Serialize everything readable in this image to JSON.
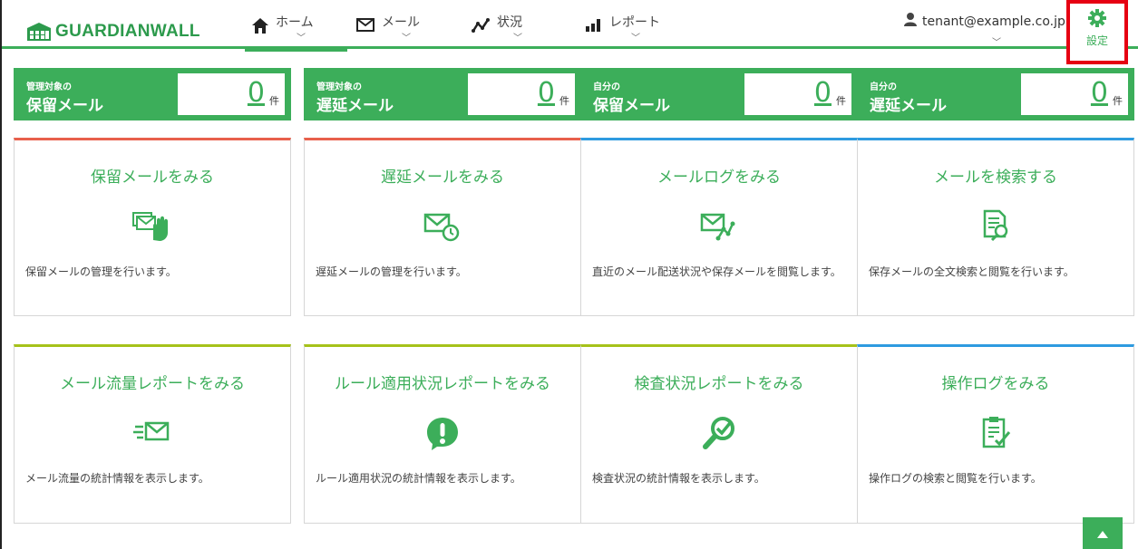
{
  "app": {
    "logo_text": "GUARDIANWALL"
  },
  "nav": {
    "home": "ホーム",
    "mail": "メール",
    "status": "状況",
    "report": "レポート"
  },
  "user": {
    "email": "tenant@example.co.jp"
  },
  "settings": {
    "label": "設定"
  },
  "counters": [
    {
      "small": "管理対象の",
      "big": "保留メール",
      "value": "0",
      "unit": "件"
    },
    {
      "small": "管理対象の",
      "big": "遅延メール",
      "value": "0",
      "unit": "件"
    },
    {
      "small": "自分の",
      "big": "保留メール",
      "value": "0",
      "unit": "件"
    },
    {
      "small": "自分の",
      "big": "遅延メール",
      "value": "0",
      "unit": "件"
    }
  ],
  "cards": [
    {
      "title": "保留メールをみる",
      "desc": "保留メールの管理を行います。",
      "icon": "hold-mail-icon"
    },
    {
      "title": "遅延メールをみる",
      "desc": "遅延メールの管理を行います。",
      "icon": "delay-mail-icon"
    },
    {
      "title": "メールログをみる",
      "desc": "直近のメール配送状況や保存メールを閲覧します。",
      "icon": "mail-log-icon"
    },
    {
      "title": "メールを検索する",
      "desc": "保存メールの全文検索と閲覧を行います。",
      "icon": "mail-search-icon"
    },
    {
      "title": "メール流量レポートをみる",
      "desc": "メール流量の統計情報を表示します。",
      "icon": "mail-flow-icon"
    },
    {
      "title": "ルール適用状況レポートをみる",
      "desc": "ルール適用状況の統計情報を表示します。",
      "icon": "rule-alert-icon"
    },
    {
      "title": "検査状況レポートをみる",
      "desc": "検査状況の統計情報を表示します。",
      "icon": "inspection-icon"
    },
    {
      "title": "操作ログをみる",
      "desc": "操作ログの検索と閲覧を行います。",
      "icon": "operation-log-icon"
    }
  ],
  "colors": {
    "brand_green": "#3cae5a",
    "red": "#e8604c",
    "blue": "#2e9be0",
    "lime": "#a6c21a",
    "highlight": "#e60012"
  }
}
